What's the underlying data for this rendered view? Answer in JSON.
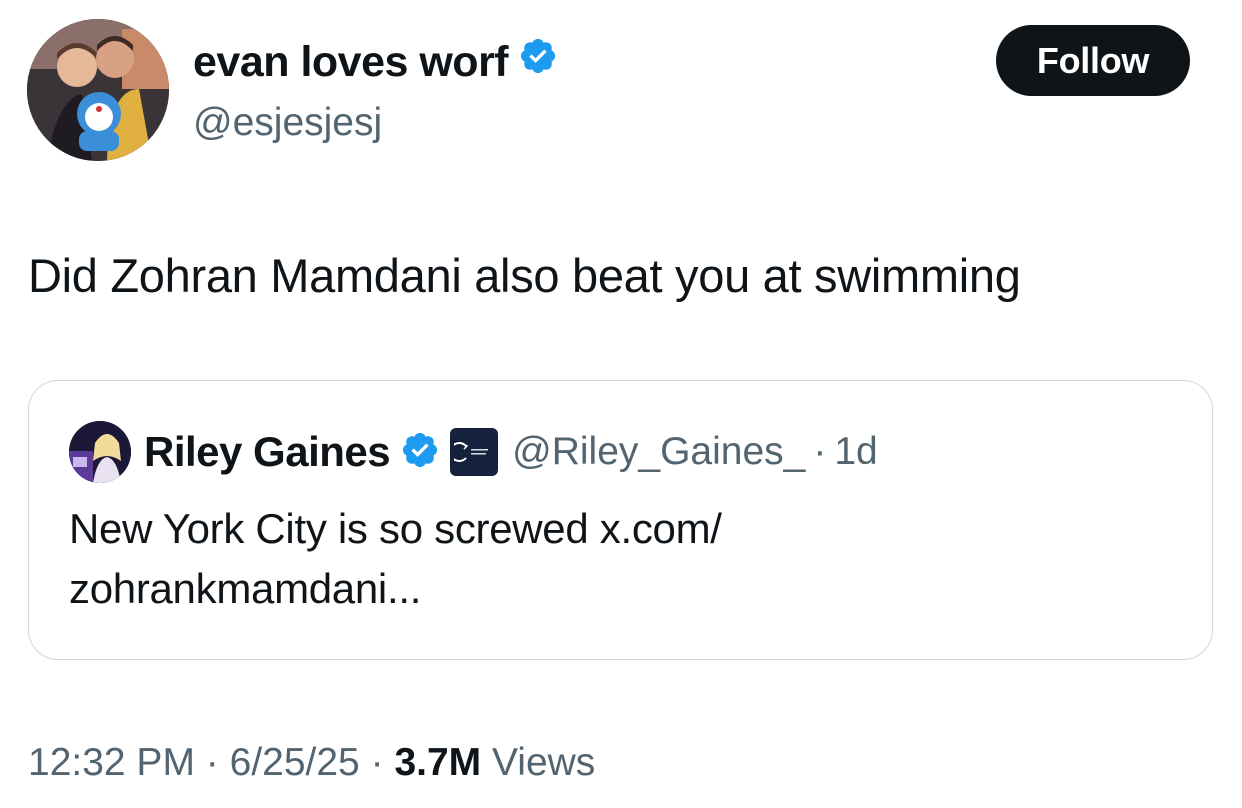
{
  "author": {
    "display_name": "evan loves worf",
    "handle": "@esjesjesj"
  },
  "follow_label": "Follow",
  "tweet_text": "Did Zohran Mamdani also beat you at swimming",
  "quoted": {
    "display_name": "Riley Gaines",
    "handle": "@Riley_Gaines_",
    "separator": "·",
    "time_ago": "1d",
    "text_line1": "New York City is so screwed x.com/",
    "text_line2": "zohrankmamdani..."
  },
  "meta": {
    "time": "12:32 PM",
    "sep1": "·",
    "date": "6/25/25",
    "sep2": "·",
    "views_count": "3.7M",
    "views_label": "Views"
  },
  "colors": {
    "text_primary": "#0f1419",
    "text_secondary": "#536471",
    "verified_blue": "#1d9bf0",
    "border": "#cfd9de"
  }
}
